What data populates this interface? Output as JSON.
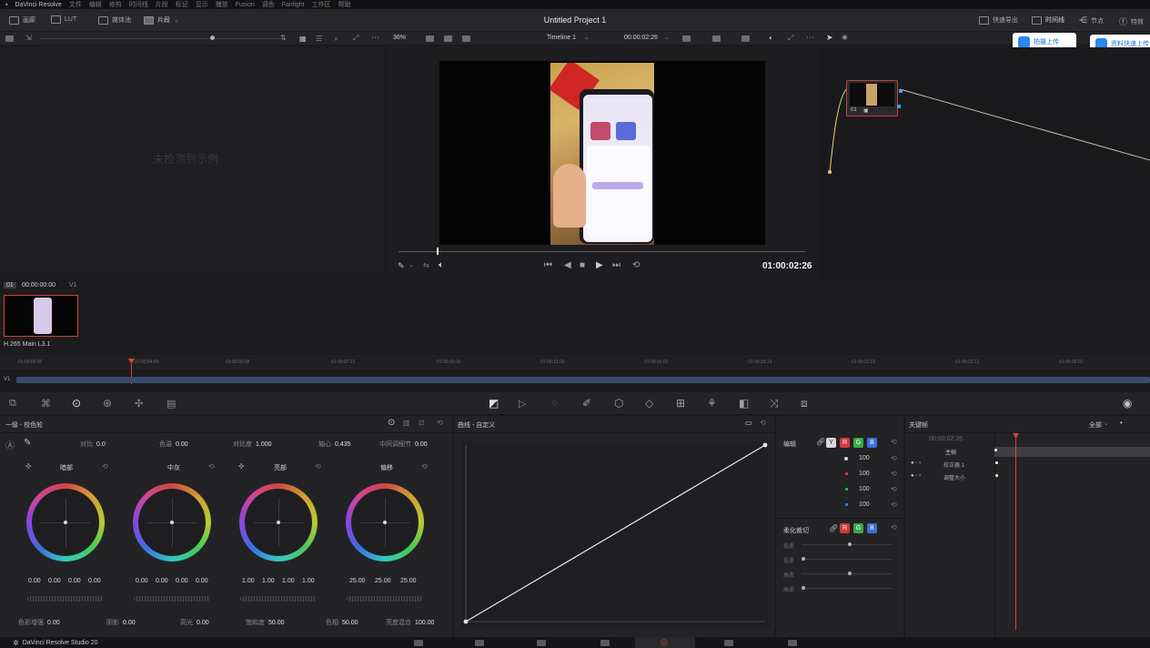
{
  "app": {
    "title": "DaVinci Resolve",
    "project_title": "Untitled Project 1",
    "footer": "DaVinci Resolve Studio 20"
  },
  "menu": [
    "文件",
    "编辑",
    "修剪",
    "时间线",
    "片段",
    "标记",
    "显示",
    "播放",
    "Fusion",
    "调色",
    "Fairlight",
    "工作区",
    "帮助"
  ],
  "toolbar": {
    "left": [
      "画廊",
      "LUT",
      "媒体池",
      "片段"
    ],
    "right": [
      "快速导出",
      "时间线",
      "节点",
      "特效"
    ],
    "upload_buttons": [
      "拍摄上传",
      "资料快速上传"
    ]
  },
  "viewer": {
    "zoom": "36%",
    "timeline_name": "Timeline 1",
    "timecode": "00:00:02:26",
    "current_timecode": "01:00:02:26",
    "left_empty": "未检测到示例"
  },
  "clip": {
    "index": "01",
    "timecode": "00:00:00:00",
    "track": "V1",
    "codec": "H.265 Main L3.1"
  },
  "ruler": {
    "ticks": [
      "01:00:00:00",
      "01:00:04:00",
      "01:00:03:08",
      "01:00:07:21",
      "01:00:10:16",
      "01:00:13:03",
      "01:00:16:02",
      "01:00:18:13",
      "01:00:21:02",
      "01:00:23:12",
      "01:00:26:02"
    ],
    "track_label": "V1"
  },
  "color_wheels": {
    "title": "一级 - 校色轮",
    "top_params": [
      {
        "label": "对比",
        "value": "0.0"
      },
      {
        "label": "色温",
        "value": "0.00"
      },
      {
        "label": "对比度",
        "value": "1.000"
      },
      {
        "label": "轴心",
        "value": "0.435"
      },
      {
        "label": "中间调细节",
        "value": "0.00"
      }
    ],
    "wheels": [
      {
        "label": "暗部",
        "values": [
          "0.00",
          "0.00",
          "0.00",
          "0.00"
        ]
      },
      {
        "label": "中灰",
        "values": [
          "0.00",
          "0.00",
          "0.00",
          "0.00"
        ]
      },
      {
        "label": "亮部",
        "values": [
          "1.00",
          "1.00",
          "1.00",
          "1.00"
        ]
      },
      {
        "label": "偏移",
        "values": [
          "25.00",
          "25.00",
          "25.00"
        ]
      }
    ],
    "bottom_params": [
      {
        "label": "色彩增强",
        "value": "0.00"
      },
      {
        "label": "阴影",
        "value": "0.00"
      },
      {
        "label": "高光",
        "value": "0.00"
      },
      {
        "label": "饱和度",
        "value": "50.00"
      },
      {
        "label": "色相",
        "value": "50.00"
      },
      {
        "label": "亮度混合",
        "value": "100.00"
      }
    ]
  },
  "curves": {
    "title": "曲线 - 自定义"
  },
  "mixer": {
    "edit_label": "编辑",
    "channels": [
      "Y",
      "R",
      "G",
      "B"
    ],
    "values": [
      "100",
      "100",
      "100",
      "100"
    ],
    "soft_clip_label": "柔化裁切",
    "soft_params": [
      "低柔",
      "低柔",
      "高柔",
      "高柔"
    ]
  },
  "keyframes": {
    "title": "关键帧",
    "filter": "全部",
    "timecode": "00:00:02:26",
    "rows": [
      "主帧",
      "校正器 1",
      "调整大小"
    ]
  },
  "colors": {
    "accent_red": "#e04040",
    "accent_blue": "#2a86f0",
    "track_blue": "#3a4c6e"
  }
}
